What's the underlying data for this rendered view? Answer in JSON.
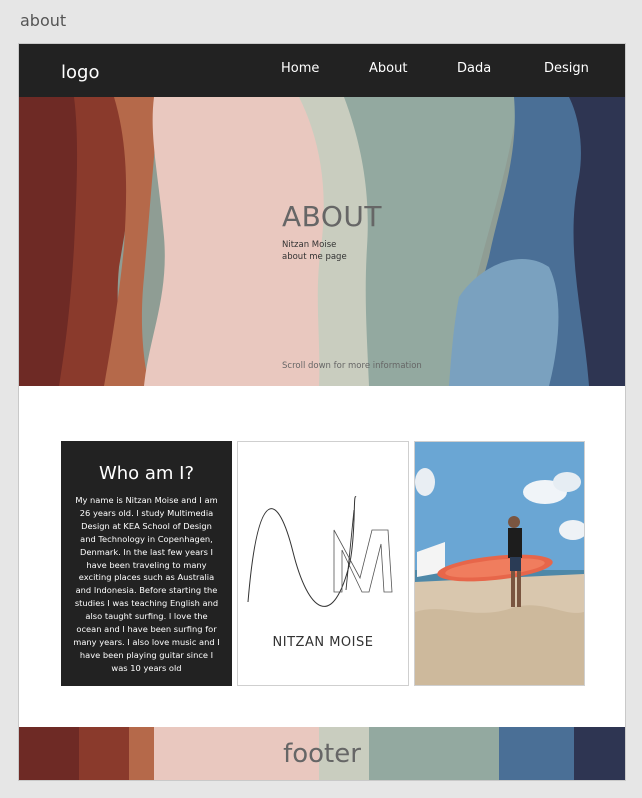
{
  "page": {
    "label": "about"
  },
  "nav": {
    "logo": "logo",
    "links": [
      "Home",
      "About",
      "Dada",
      "Design"
    ]
  },
  "hero": {
    "title": "ABOUT",
    "subtitle_line1": "Nitzan Moise",
    "subtitle_line2": "about me page",
    "scroll_text": "Scroll down for more information"
  },
  "about": {
    "heading": "Who am I?",
    "body": "My name is Nitzan Moise and I am 26 years old. I study Multimedia Design at KEA School of Design and Technology in Copenhagen, Denmark. In the last few years I have been traveling to many exciting places such as Australia and Indonesia. Before starting the studies I was teaching English and also taught surfing. I love the ocean and I have been surfing for many years. I also love music and I have been playing guitar since I was 10 years old"
  },
  "brand": {
    "name": "NITZAN MOISE"
  },
  "footer": {
    "text": "footer"
  },
  "colors": {
    "nav_bg": "#222222",
    "about_bg": "#222222",
    "hero_palette": [
      "#6e2a25",
      "#b5694a",
      "#e9c8bf",
      "#c9cdbf",
      "#93a9a0",
      "#4a6f96",
      "#2e3552"
    ]
  }
}
